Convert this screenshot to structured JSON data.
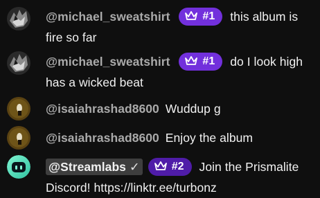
{
  "colors": {
    "background": "#0f0f0f",
    "author_text": "#aaaaaa",
    "message_text": "#f1f1f1",
    "badge_rank_1": "#7230dc",
    "badge_rank_2": "#4f1ca8",
    "moderator_box": "#3e3e3e"
  },
  "messages": [
    {
      "author": "@michael_sweatshirt",
      "badge_icon": "crown-icon",
      "badge": "#1",
      "text": "this album is fire so far"
    },
    {
      "author": "@michael_sweatshirt",
      "badge_icon": "crown-icon",
      "badge": "#1",
      "text": "do I look high has a wicked beat"
    },
    {
      "author": "@isaiahrashad8600",
      "text": "Wuddup g"
    },
    {
      "author": "@isaiahrashad8600",
      "text": "Enjoy the album"
    },
    {
      "author": "@Streamlabs",
      "verified_icon": "checkmark-icon",
      "badge_icon": "crown-icon",
      "badge": "#2",
      "text": "Join the Prismalite Discord! https://linktr.ee/turbonz"
    }
  ]
}
